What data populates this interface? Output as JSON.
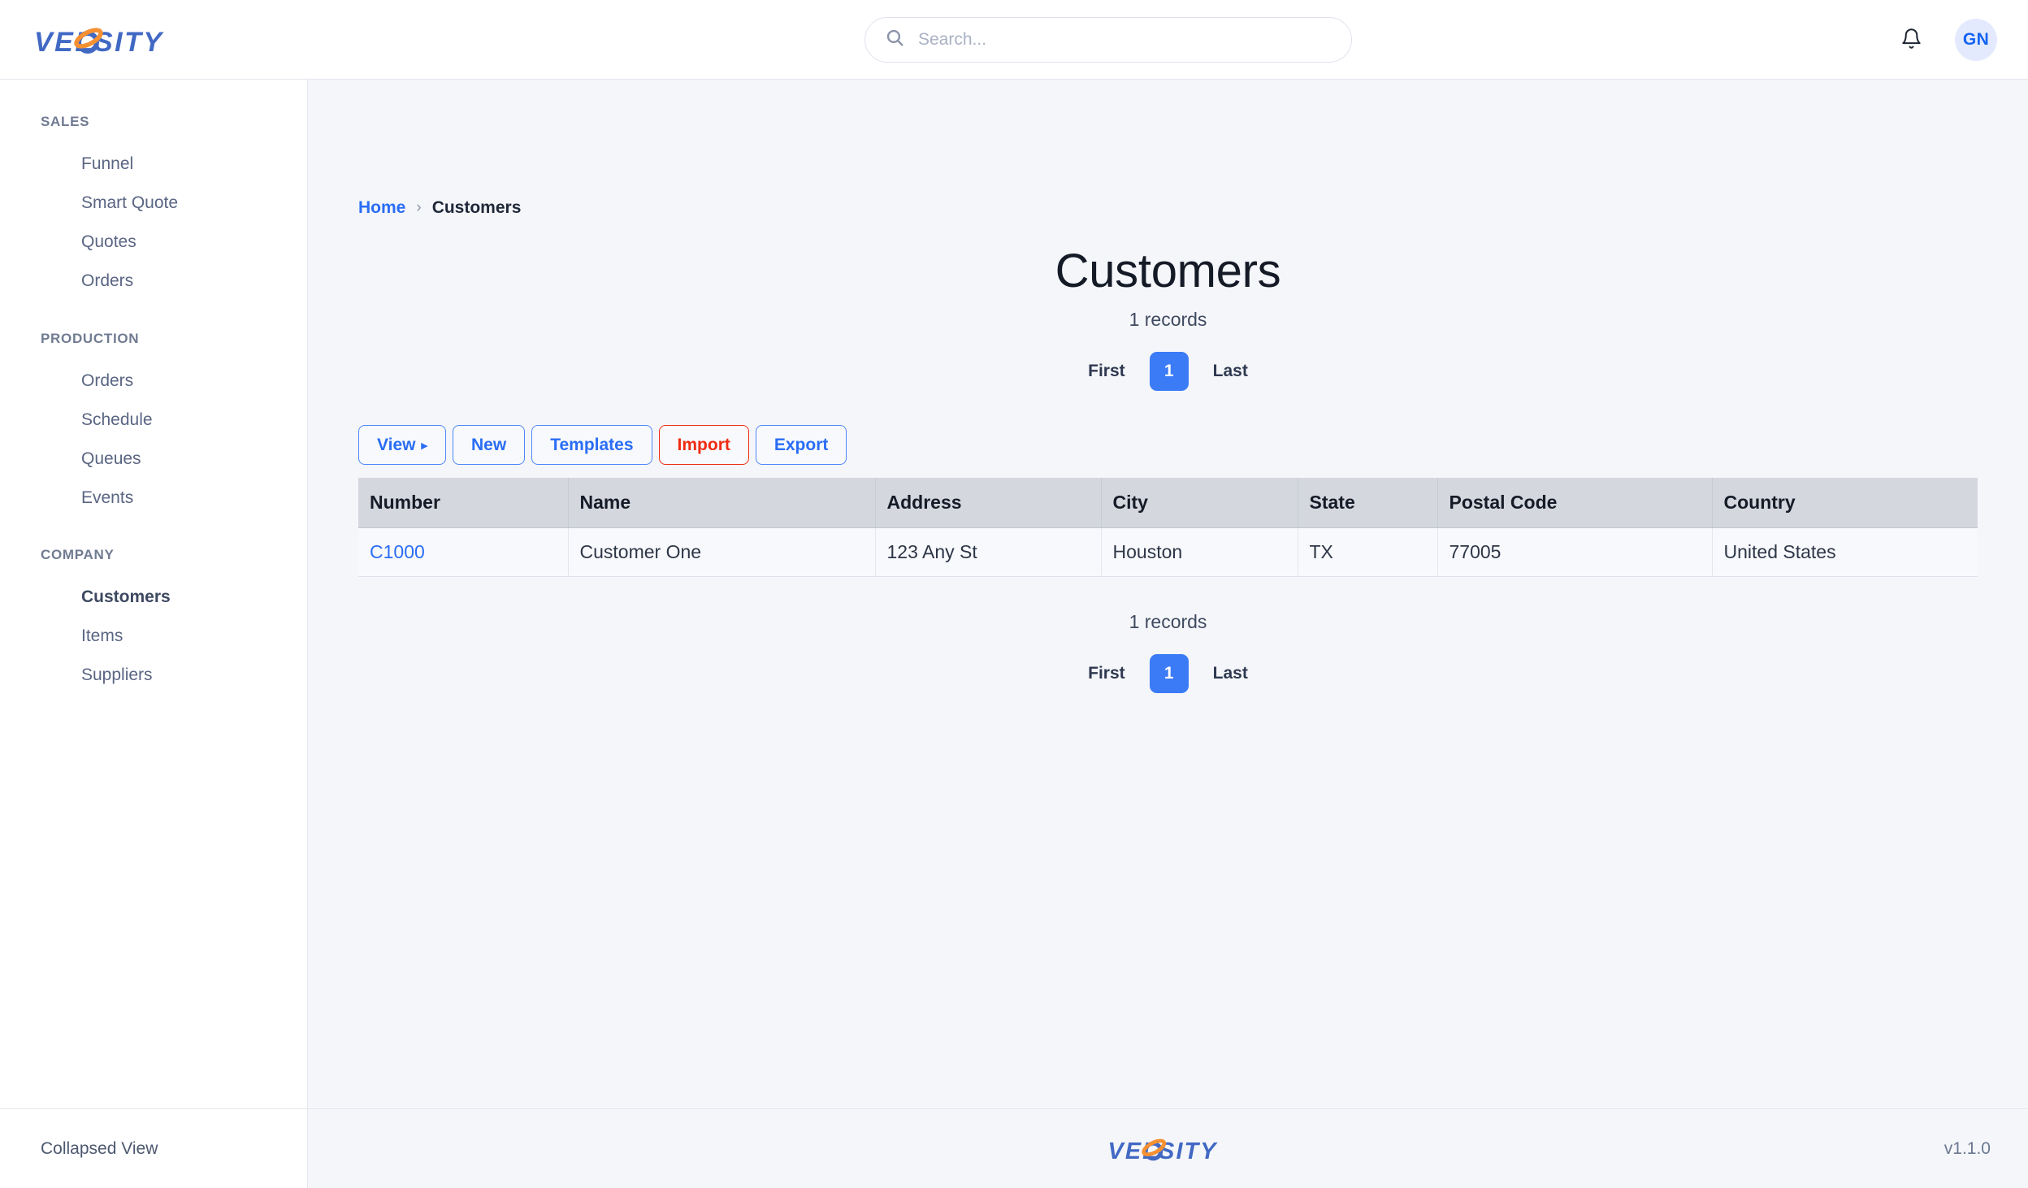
{
  "brand": {
    "name": "VELOSITY",
    "logo_text_before": "VEL",
    "logo_text_after": "SITY",
    "blue": "#4169c4",
    "orange": "#f59033"
  },
  "header": {
    "search": {
      "placeholder": "Search...",
      "value": "",
      "icon": "search-icon"
    },
    "notifications_icon": "bell-icon",
    "avatar_initials": "GN",
    "avatar_bg": "#e4eafe",
    "avatar_fg": "#1463f3"
  },
  "sidebar": {
    "groups": [
      {
        "title": "SALES",
        "items": [
          {
            "label": "Funnel",
            "active": false
          },
          {
            "label": "Smart Quote",
            "active": false
          },
          {
            "label": "Quotes",
            "active": false
          },
          {
            "label": "Orders",
            "active": false
          }
        ]
      },
      {
        "title": "PRODUCTION",
        "items": [
          {
            "label": "Orders",
            "active": false
          },
          {
            "label": "Schedule",
            "active": false
          },
          {
            "label": "Queues",
            "active": false
          },
          {
            "label": "Events",
            "active": false
          }
        ]
      },
      {
        "title": "COMPANY",
        "items": [
          {
            "label": "Customers",
            "active": true
          },
          {
            "label": "Items",
            "active": false
          },
          {
            "label": "Suppliers",
            "active": false
          }
        ]
      }
    ],
    "footer_label": "Collapsed View"
  },
  "breadcrumb": {
    "home": "Home",
    "separator": "›",
    "current": "Customers"
  },
  "page": {
    "title": "Customers",
    "records_label": "1 records"
  },
  "pagination": {
    "first": "First",
    "current_page": "1",
    "last": "Last",
    "active_bg": "#3b7bf6"
  },
  "toolbar": {
    "view": "View",
    "view_caret": "▸",
    "new": "New",
    "templates": "Templates",
    "import": "Import",
    "export": "Export",
    "primary_color": "#2a6df5",
    "danger_color": "#ef2b12"
  },
  "table": {
    "columns": [
      "Number",
      "Name",
      "Address",
      "City",
      "State",
      "Postal Code",
      "Country"
    ],
    "rows": [
      {
        "number": "C1000",
        "name": "Customer One",
        "address": "123 Any St",
        "city": "Houston",
        "state": "TX",
        "postal_code": "77005",
        "country": "United States"
      }
    ],
    "header_bg": "#d4d7de"
  },
  "footer": {
    "version": "v1.1.0"
  }
}
